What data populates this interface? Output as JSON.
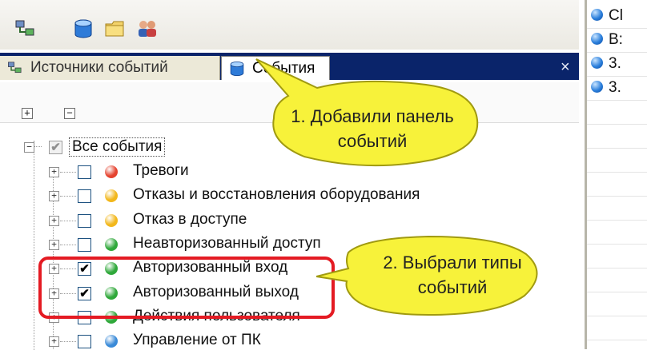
{
  "window": {
    "tabs": [
      {
        "label": "Источники событий"
      },
      {
        "label": "События"
      }
    ],
    "close_glyph": "×"
  },
  "toolbar": {
    "icons": [
      "network-source-icon",
      "database-icon",
      "folder-icon",
      "users-icon"
    ]
  },
  "tree_buttons": {
    "expand_all": "+",
    "collapse_all": "−"
  },
  "tree": {
    "root": {
      "label": "Все события",
      "checked": "partial"
    },
    "items": [
      {
        "label": "Тревоги",
        "checked": false,
        "dot": "#e5432f"
      },
      {
        "label": "Отказы и восстановления оборудования",
        "checked": false,
        "dot": "#f2b71b"
      },
      {
        "label": "Отказ в доступе",
        "checked": false,
        "dot": "#f2b71b"
      },
      {
        "label": "Неавторизованный доступ",
        "checked": false,
        "dot": "#2fa83a"
      },
      {
        "label": "Авторизованный вход",
        "checked": true,
        "dot": "#2fa83a"
      },
      {
        "label": "Авторизованный выход",
        "checked": true,
        "dot": "#2fa83a"
      },
      {
        "label": "Действия пользователя",
        "checked": false,
        "dot": "#2fa83a"
      },
      {
        "label": "Управление от ПК",
        "checked": false,
        "dot": "#3a8ad8"
      }
    ],
    "check_glyph": "✔",
    "expand_glyph": "+"
  },
  "right_panel": {
    "rows": [
      "Cl",
      "B:",
      "3.",
      "3."
    ]
  },
  "callouts": [
    {
      "text": "1. Добавили панель событий"
    },
    {
      "text": "2. Выбрали типы событий"
    }
  ],
  "colors": {
    "tab_bar": "#0a246a",
    "highlight_frame": "#e41b23",
    "callout_fill": "#f7f23a",
    "callout_stroke": "#a09a10"
  }
}
